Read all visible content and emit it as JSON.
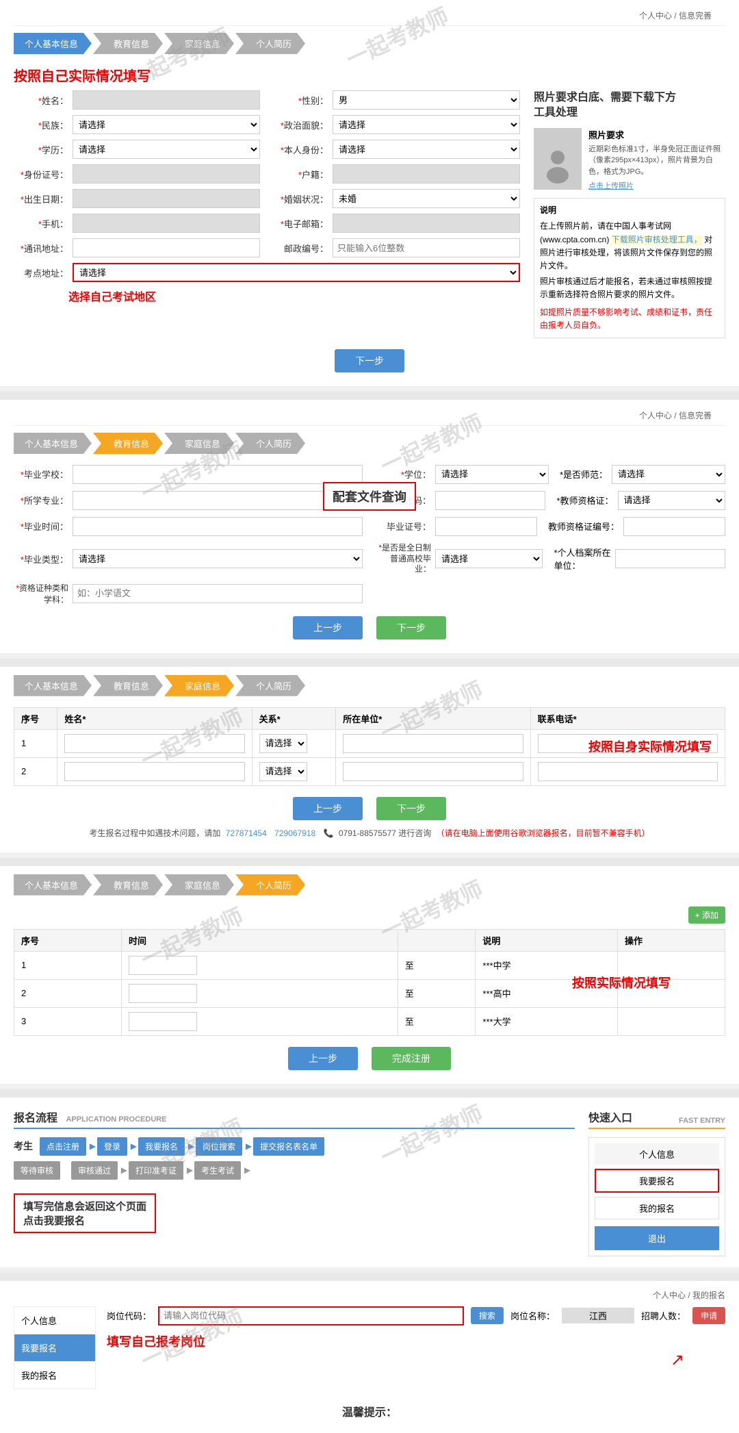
{
  "breadcrumb1": {
    "home": "个人中心",
    "sep": " / ",
    "current": "信息完善"
  },
  "section1": {
    "annotation": "按照自己实际情况填写",
    "steps": [
      {
        "label": "个人基本信息",
        "state": "blue"
      },
      {
        "label": "教育信息",
        "state": "normal"
      },
      {
        "label": "家庭信息",
        "state": "normal"
      },
      {
        "label": "个人简历",
        "state": "normal"
      }
    ],
    "fields": {
      "name_label": "姓名：",
      "gender_label": "性别：",
      "gender_value": "男",
      "nationality_label": "民族：",
      "nationality_placeholder": "请选择",
      "political_label": "政治面貌：",
      "political_placeholder": "请选择",
      "education_label": "学历：",
      "education_placeholder": "请选择",
      "identity_label": "本人身份：",
      "identity_placeholder": "请选择",
      "id_number_label": "身份证号：",
      "household_label": "户籍：",
      "birthdate_label": "出生日期：",
      "marital_label": "婚姻状况：",
      "marital_value": "未婚",
      "phone_label": "手机：",
      "email_label": "电子邮箱：",
      "address_label": "通讯地址：",
      "postal_label": "邮政编号：",
      "postal_placeholder": "只能输入6位整数",
      "exam_label": "考点地址：",
      "exam_placeholder": "请选择",
      "exam_annotation": "选择自己考试地区"
    },
    "photo": {
      "req_title": "照片要求",
      "req_desc": "近期彩色标准1寸，半身免冠正面证件照（像素295px×413px），照片背景为白色，格式为JPG。",
      "upload_label": "点击上传照片",
      "notice_title": "说明",
      "notice_text1": "在上传照片前，请在中国人事考试网(www.cpta.com.cn)",
      "notice_link": "下载照片审核处理工具，",
      "notice_text2": "对照片进行审核处理，将该照片文件保存到您的照片文件。",
      "notice_text3": "照片审核通过后才能报名，若未通过审核照按提示重新选择符合照片要求的照片文件。",
      "notice_warn": "如提照片质量不够影响考试、成绩和证书，责任由报考人员自负。",
      "photo_req_top": "照片要求白底、需要下载下方\n工具处理"
    },
    "next_btn": "下一步"
  },
  "section2": {
    "steps": [
      {
        "label": "个人基本信息",
        "state": "normal"
      },
      {
        "label": "教育信息",
        "state": "orange"
      },
      {
        "label": "家庭信息",
        "state": "normal"
      },
      {
        "label": "个人简历",
        "state": "normal"
      }
    ],
    "fields": {
      "school_label": "毕业学校：",
      "degree_label": "学位：",
      "degree_placeholder": "请选择",
      "is_teacher_label": "是否师范：",
      "is_teacher_placeholder": "请选择",
      "major_label": "所学专业：",
      "major_code_label": "专业代码：",
      "teacher_cert_label": "教师资格证：",
      "teacher_cert_placeholder": "请选择",
      "grad_time_label": "毕业时间：",
      "grad_cert_label": "毕业证号：",
      "teacher_cert_no_label": "教师资格证编号：",
      "grad_type_label": "毕业类型：",
      "grad_type_placeholder": "请选择",
      "is_fulltime_label": "是否是全日制\n普通高校毕\n业：",
      "is_fulltime_placeholder": "请选择",
      "personal_file_label": "个人档案所在\n单位：",
      "cert_subject_label": "资格证种类和\n学科：",
      "cert_subject_placeholder": "如：小学语文"
    },
    "overlay_annotation": "配套文件查询",
    "prev_btn": "上一步",
    "next_btn": "下一步"
  },
  "section3": {
    "steps": [
      {
        "label": "个人基本信息",
        "state": "normal"
      },
      {
        "label": "教育信息",
        "state": "normal"
      },
      {
        "label": "家庭信息",
        "state": "orange"
      },
      {
        "label": "个人简历",
        "state": "normal"
      }
    ],
    "table": {
      "cols": [
        "序号",
        "姓名*",
        "关系*",
        "所在单位*",
        "联系电话*"
      ],
      "rows": [
        {
          "no": "1",
          "name": "",
          "rel_placeholder": "请选择",
          "unit": "",
          "phone": ""
        },
        {
          "no": "2",
          "name": "",
          "rel_placeholder": "请选择",
          "unit": "",
          "phone": ""
        }
      ]
    },
    "annotation": "按照自身实际情况填写",
    "prev_btn": "上一步",
    "next_btn": "下一步",
    "footer_note": "考生报名过程中如遇技术问题，请加",
    "footer_qq1": "727871454",
    "footer_qq2": "729067918",
    "footer_phone": "0791-88575577",
    "footer_note2": "进行咨询",
    "footer_warn": "（请在电脑上面使用谷歌浏览器报名，目前暂不兼容手机）"
  },
  "section4": {
    "steps": [
      {
        "label": "个人基本信息",
        "state": "normal"
      },
      {
        "label": "教育信息",
        "state": "normal"
      },
      {
        "label": "家庭信息",
        "state": "normal"
      },
      {
        "label": "个人简历",
        "state": "orange"
      }
    ],
    "add_btn": "+ 添加",
    "table": {
      "cols": [
        "序号",
        "时间",
        "",
        "说明",
        "操作"
      ],
      "rows": [
        {
          "no": "1",
          "from": "",
          "to": "至",
          "desc": "***中学"
        },
        {
          "no": "2",
          "from": "",
          "to": "至",
          "desc": "***高中"
        },
        {
          "no": "3",
          "from": "",
          "to": "至",
          "desc": "***大学"
        }
      ]
    },
    "annotation": "按照实际情况填写",
    "prev_btn": "上一步",
    "complete_btn": "完成注册"
  },
  "flow_section": {
    "left_title": "报名流程",
    "left_title_en": "APPLICATION PROCEDURE",
    "right_title": "快速入口",
    "right_title_en": "FAST ENTRY",
    "applicant_label": "考生",
    "flow_row1": [
      {
        "label": "点击注册",
        "style": "blue"
      },
      {
        "label": "登录",
        "style": "blue"
      },
      {
        "label": "我要报名",
        "style": "blue"
      },
      {
        "label": "岗位搜索",
        "style": "blue"
      },
      {
        "label": "提交报名表名单",
        "style": "blue"
      }
    ],
    "flow_row2": [
      {
        "label": "考生考试",
        "style": "gray"
      },
      {
        "label": "打印准考证",
        "style": "gray"
      },
      {
        "label": "审核通过",
        "style": "gray"
      },
      {
        "label": "等待审核",
        "style": "gray"
      }
    ],
    "flow_annotation": "填写完信息会返回这个页面\n点击我要报名",
    "quick_items": [
      {
        "label": "个人信息",
        "type": "header"
      },
      {
        "label": "我要报名",
        "type": "highlighted"
      },
      {
        "label": "我的报名",
        "type": "normal"
      }
    ],
    "logout_btn": "退出"
  },
  "bottom_section": {
    "breadcrumb": {
      "home": "个人中心",
      "sep": " / ",
      "current": "我的报名"
    },
    "nav": [
      {
        "label": "个人信息",
        "active": false
      },
      {
        "label": "我要报名",
        "active": false
      },
      {
        "label": "我的报名",
        "active": false
      }
    ],
    "search": {
      "code_label": "岗位代码：",
      "code_placeholder": "请输入岗位代码",
      "search_btn": "搜索",
      "name_label": "岗位名称：",
      "name_value": "江西",
      "recruits_label": "招聘人数：",
      "apply_btn": "申请"
    },
    "annotation": "填写自己报考岗位",
    "warm_tip": "温馨提示："
  }
}
